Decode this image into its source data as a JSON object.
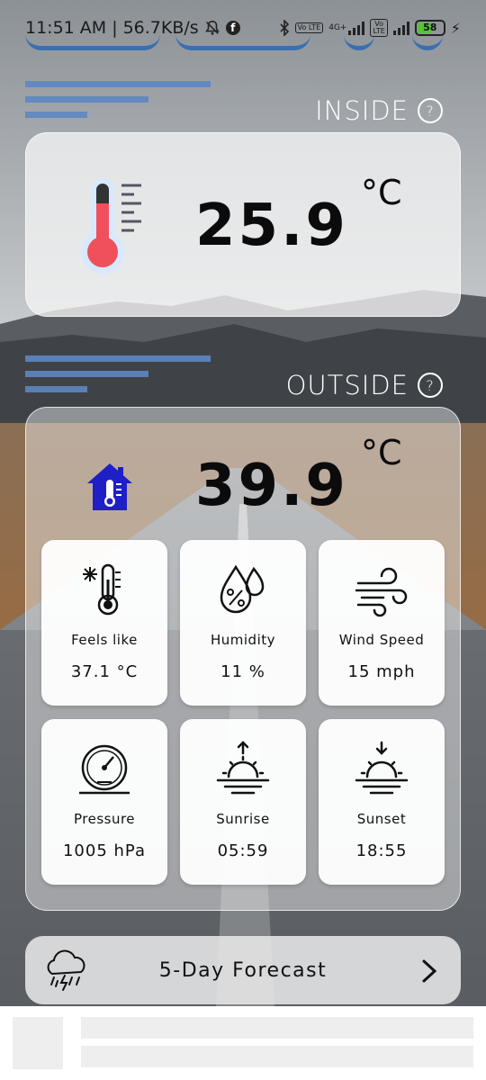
{
  "status": {
    "time": "11:51 AM",
    "separator": "|",
    "speed": "56.7KB/s",
    "network": "4G+",
    "volte": "Vo LTE",
    "battery": "58"
  },
  "inside": {
    "label": "INSIDE",
    "help": "?",
    "temperature": "25.9",
    "unit": "°C"
  },
  "outside": {
    "label": "OUTSIDE",
    "help": "?",
    "temperature": "39.9",
    "unit": "°C"
  },
  "tiles": [
    {
      "label": "Feels like",
      "value": "37.1 °C",
      "icon": "thermometer-snowflake-icon"
    },
    {
      "label": "Humidity",
      "value": "11 %",
      "icon": "humidity-drops-icon"
    },
    {
      "label": "Wind Speed",
      "value": "15 mph",
      "icon": "wind-icon"
    },
    {
      "label": "Pressure",
      "value": "1005 hPa",
      "icon": "gauge-icon"
    },
    {
      "label": "Sunrise",
      "value": "05:59",
      "icon": "sunrise-icon"
    },
    {
      "label": "Sunset",
      "value": "18:55",
      "icon": "sunset-icon"
    }
  ],
  "forecast": {
    "label": "5-Day Forecast",
    "icon": "storm-cloud-icon",
    "chevron": "chevron-right-icon"
  },
  "colors": {
    "accent_blue": "#3a6fb0",
    "thermo_red": "#f0505c",
    "house_blue": "#1f1fc8"
  }
}
